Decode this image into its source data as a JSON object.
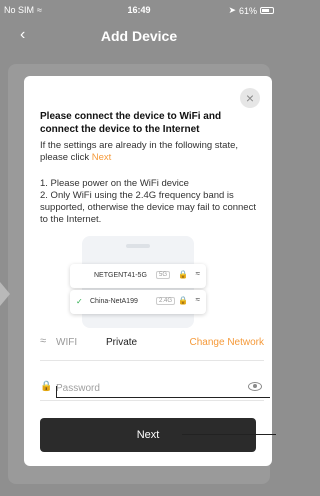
{
  "status_bar": {
    "carrier": "No SIM",
    "time": "16:49",
    "battery": "61%"
  },
  "nav": {
    "back_icon": "chevron-left-icon",
    "title": "Add Device"
  },
  "modal": {
    "close_icon": "close-icon",
    "heading": "Please connect the device to WiFi and connect the device to the Internet",
    "hint_text": "If the settings are already in the following state, please click ",
    "hint_link": "Next",
    "step1": "1. Please power on the WiFi device",
    "step2": "2. Only WiFi using the 2.4G frequency band is supported, otherwise the device may fail to connect to the Internet.",
    "networks": [
      {
        "name": "NETGENT41-5G",
        "band": "5G",
        "checked": false
      },
      {
        "name": "China-NetA199",
        "band": "2.4G",
        "checked": true
      }
    ],
    "wifi": {
      "label": "WIFI",
      "value": "Private",
      "change_label": "Change Network"
    },
    "password": {
      "placeholder": "Password",
      "value": ""
    },
    "next_label": "Next"
  },
  "colors": {
    "accent": "#f59a3a",
    "button": "#2b2b2b",
    "check": "#2fae4f"
  }
}
